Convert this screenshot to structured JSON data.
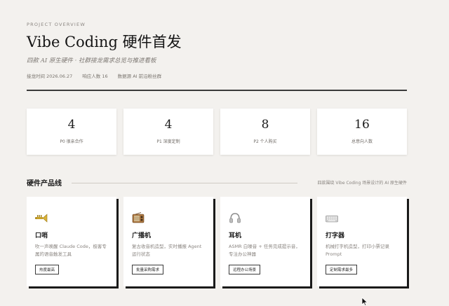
{
  "header": {
    "eyebrow": "PROJECT OVERVIEW",
    "title": "Vibe Coding 硬件首发",
    "subtitle": "四款 AI 原生硬件 · 社群接龙需求总览与推进看板",
    "meta": [
      "接龙时间 2026.06.27",
      "响应人数 16",
      "数据源 AI 前沿粉丝群"
    ]
  },
  "stats": [
    {
      "value": "4",
      "label": "P0 很亲合作"
    },
    {
      "value": "4",
      "label": "P1 深度定制"
    },
    {
      "value": "8",
      "label": "P2 个人购买"
    },
    {
      "value": "16",
      "label": "总意向人数"
    }
  ],
  "section": {
    "title": "硬件产品线",
    "note": "四款围绕 Vibe Coding 场景设计的 AI 原生硬件"
  },
  "products": [
    {
      "icon": "trumpet-icon",
      "name": "口哨",
      "desc": "吹一声唤醒 Claude Code，极客专属的语音触发工具",
      "tag": "热度最高"
    },
    {
      "icon": "radio-icon",
      "name": "广播机",
      "desc": "复古收音机造型，实时播报 Agent 运行状态",
      "tag": "批量采购需求"
    },
    {
      "icon": "headphones-icon",
      "name": "耳机",
      "desc": "ASMR 白噪音 + 任务完成提示音，专注办公神器",
      "tag": "远程办公场景"
    },
    {
      "icon": "keyboard-icon",
      "name": "打字器",
      "desc": "机械打字机造型，打印小票记录 Prompt",
      "tag": "定制需求最多"
    }
  ],
  "colors": {
    "background": "#f3f1ee",
    "card": "#ffffff",
    "ink": "#1a1a1a",
    "muted": "#8a8580"
  }
}
